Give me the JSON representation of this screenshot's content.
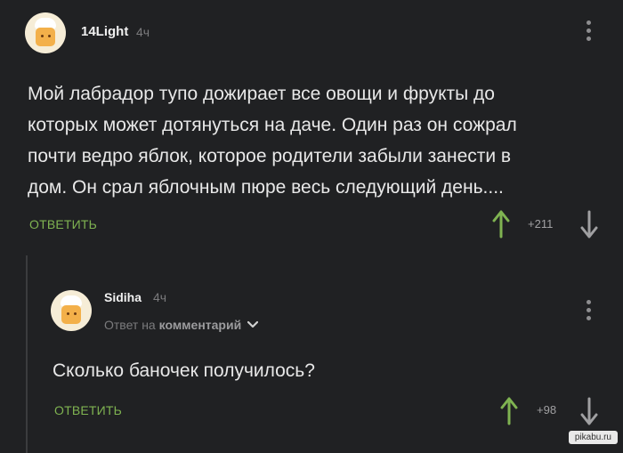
{
  "comment": {
    "username": "14Light",
    "time": "4ч",
    "text_lines": [
      "Мой лабрадор тупо дожирает все овощи и фрукты до",
      "которых может дотянуться на даче. Один раз он сожрал",
      "почти ведро яблок, которое родители забыли занести в",
      "дом. Он срал яблочным пюре весь следующий день...."
    ],
    "reply_label": "ОТВЕТИТЬ",
    "score": "+211"
  },
  "reply_comment": {
    "username": "Sidiha",
    "time": "4ч",
    "reply_to_prefix": "Ответ на",
    "reply_to_target": "комментарий",
    "text": "Сколько баночек получилось?",
    "reply_label": "ОТВЕТИТЬ",
    "score": "+98"
  },
  "watermark": "pikabu.ru",
  "colors": {
    "background": "#202123",
    "accent_green": "#7fb351",
    "muted_text": "#7b7b7d"
  }
}
